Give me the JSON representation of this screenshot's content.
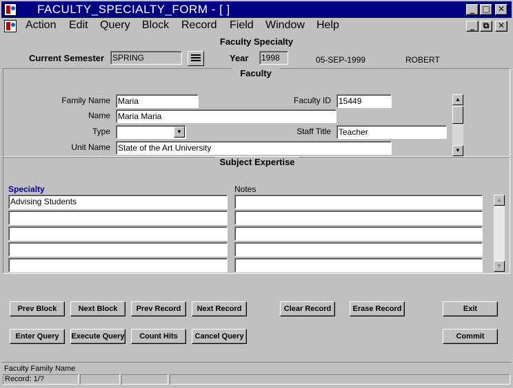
{
  "window": {
    "title": "FACULTY_SPECIALTY_FORM - [ ]",
    "minimize": "_",
    "maximize": "□",
    "close": "✕"
  },
  "menu": {
    "items": [
      {
        "label": "Action"
      },
      {
        "label": "Edit"
      },
      {
        "label": "Query"
      },
      {
        "label": "Block"
      },
      {
        "label": "Record"
      },
      {
        "label": "Field"
      },
      {
        "label": "Window"
      },
      {
        "label": "Help"
      }
    ],
    "minimize": "_",
    "restore": "⧉",
    "close": "✕"
  },
  "form": {
    "title": "Faculty Specialty",
    "current_semester_label": "Current Semester",
    "current_semester_value": "SPRING",
    "list_icon": "list-icon",
    "year_label": "Year",
    "year_value": "1998",
    "date": "05-SEP-1999",
    "user": "ROBERT"
  },
  "faculty": {
    "section_title": "Faculty",
    "family_name_label": "Family Name",
    "family_name_value": "Maria",
    "faculty_id_label": "Faculty ID",
    "faculty_id_value": "15449",
    "name_label": "Name",
    "name_value": "Maria  Maria",
    "type_label": "Type",
    "type_value": "",
    "staff_title_label": "Staff Title",
    "staff_title_value": "Teacher",
    "unit_name_label": "Unit Name",
    "unit_name_value": "State of the Art University"
  },
  "expertise": {
    "section_title": "Subject Expertise",
    "specialty_header": "Specialty",
    "notes_header": "Notes",
    "rows": [
      {
        "specialty": "Advising Students",
        "notes": ""
      },
      {
        "specialty": "",
        "notes": ""
      },
      {
        "specialty": "",
        "notes": ""
      },
      {
        "specialty": "",
        "notes": ""
      },
      {
        "specialty": "",
        "notes": ""
      }
    ]
  },
  "buttons": {
    "prev_block": "Prev Block",
    "next_block": "Next Block",
    "prev_record": "Prev Record",
    "next_record": "Next Record",
    "clear_record": "Clear Record",
    "erase_record": "Erase Record",
    "exit": "Exit",
    "enter_query": "Enter Query",
    "execute_query": "Execute Query",
    "count_hits": "Count Hits",
    "cancel_query": "Cancel Query",
    "commit": "Commit"
  },
  "status": {
    "hint": "Faculty Family Name",
    "record": "Record: 1/?"
  },
  "colors": {
    "titlebar": "#000080",
    "header_blue": "#0000a0",
    "face": "#c0c0c0"
  }
}
